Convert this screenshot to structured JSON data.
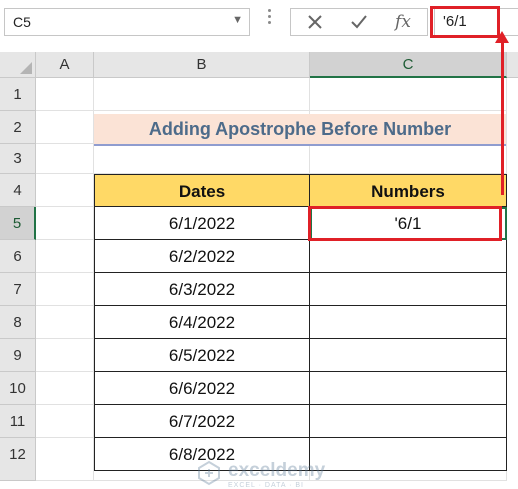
{
  "formula_bar": {
    "name_box": "C5",
    "cancel_icon": "x-icon",
    "enter_icon": "check-icon",
    "fx_label": "fx",
    "formula": "'6/1"
  },
  "columns": [
    "A",
    "B",
    "C"
  ],
  "rows": [
    "1",
    "2",
    "3",
    "4",
    "5",
    "6",
    "7",
    "8",
    "9",
    "10",
    "11",
    "12"
  ],
  "title": "Adding Apostrophe Before Number",
  "table": {
    "headers": [
      "Dates",
      "Numbers"
    ],
    "dates": [
      "6/1/2022",
      "6/2/2022",
      "6/3/2022",
      "6/4/2022",
      "6/5/2022",
      "6/6/2022",
      "6/7/2022",
      "6/8/2022"
    ],
    "numbers": [
      "'6/1",
      "",
      "",
      "",
      "",
      "",
      "",
      ""
    ]
  },
  "watermark": {
    "name": "exceldemy",
    "tagline": "EXCEL · DATA · BI"
  },
  "colors": {
    "header_fill": "#ffd966",
    "title_fill": "#fbe3d6",
    "highlight_red": "#e02027",
    "selection_green": "#217346"
  }
}
